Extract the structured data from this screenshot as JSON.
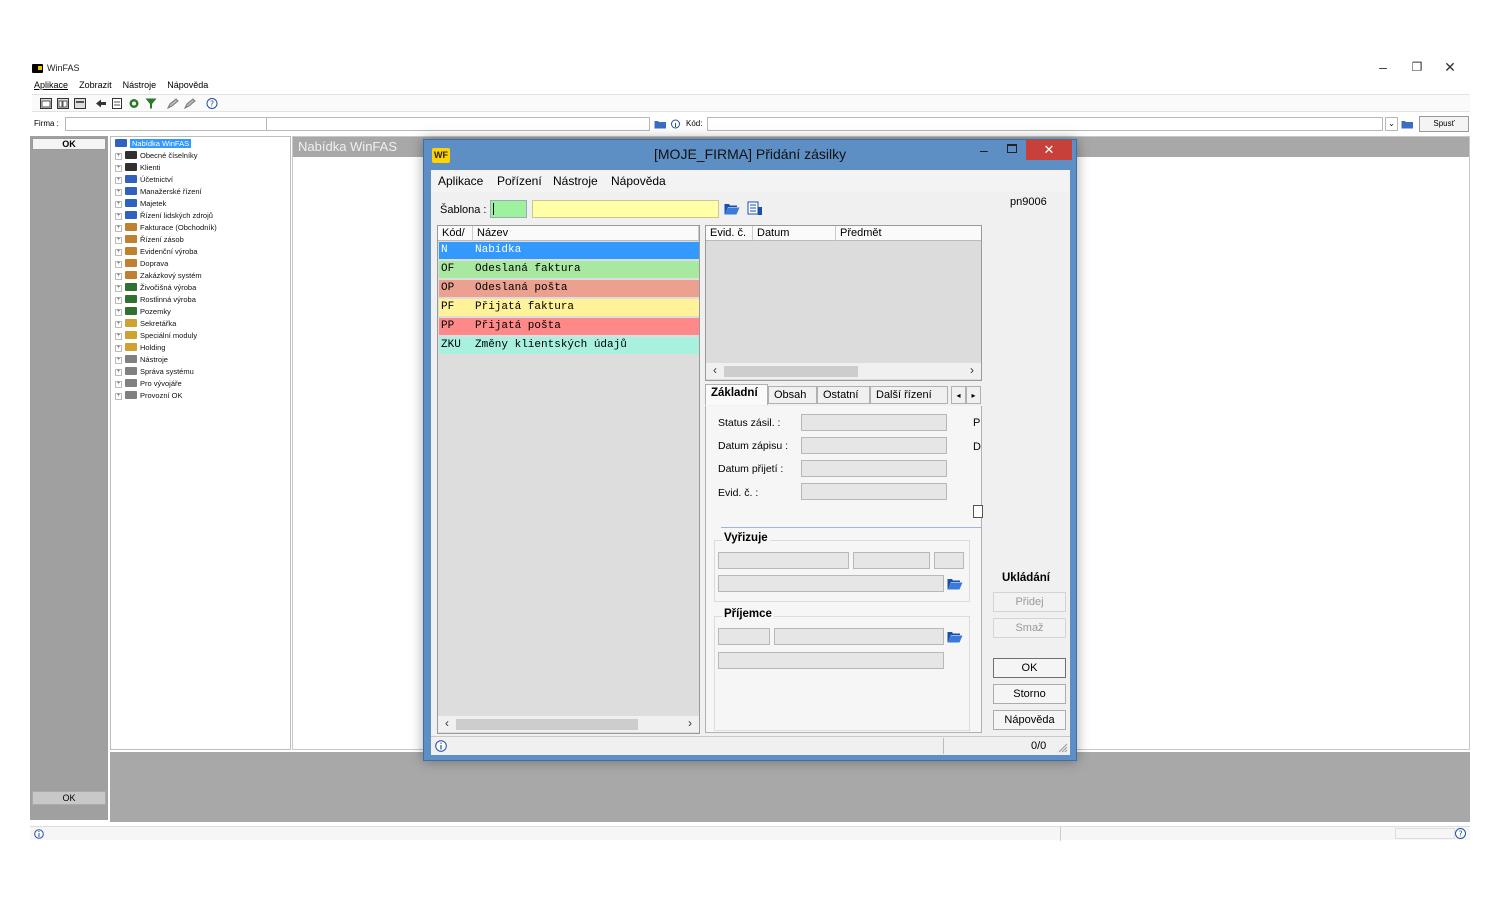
{
  "main": {
    "title": "WinFAS",
    "menus": [
      "Aplikace",
      "Zobrazit",
      "Nástroje",
      "Nápověda"
    ],
    "filter": {
      "firma_label": "Firma :",
      "kod_label": "Kód:",
      "spust_label": "Spusť"
    },
    "left_ok_top": "OK",
    "left_ok_bottom": "OK",
    "panel_title": "Nabídka WinFAS",
    "tree": [
      {
        "label": "Nabídka WinFAS",
        "color": "#3060c0",
        "selected": true
      },
      {
        "label": "Obecné číselníky",
        "color": "#303030"
      },
      {
        "label": "Klienti",
        "color": "#303030"
      },
      {
        "label": "Účetnictví",
        "color": "#3060c0"
      },
      {
        "label": "Manažerské řízení",
        "color": "#3060c0"
      },
      {
        "label": "Majetek",
        "color": "#3060c0"
      },
      {
        "label": "Řízení lidských zdrojů",
        "color": "#3060c0"
      },
      {
        "label": "Fakturace (Obchodník)",
        "color": "#c08030"
      },
      {
        "label": "Řízení zásob",
        "color": "#c08030"
      },
      {
        "label": "Evidenční výroba",
        "color": "#c08030"
      },
      {
        "label": "Doprava",
        "color": "#c08030"
      },
      {
        "label": "Zakázkový systém",
        "color": "#c08030"
      },
      {
        "label": "Živočišná výroba",
        "color": "#307030"
      },
      {
        "label": "Rostlinná výroba",
        "color": "#307030"
      },
      {
        "label": "Pozemky",
        "color": "#307030"
      },
      {
        "label": "Sekretářka",
        "color": "#d0a030"
      },
      {
        "label": "Speciální moduly",
        "color": "#d0a030"
      },
      {
        "label": "Holding",
        "color": "#d0a030"
      },
      {
        "label": "Nástroje",
        "color": "#808080"
      },
      {
        "label": "Správa systému",
        "color": "#808080"
      },
      {
        "label": "Pro vývojáře",
        "color": "#808080"
      },
      {
        "label": "Provozní OK",
        "color": "#808080"
      }
    ]
  },
  "dialog": {
    "title": "[MOJE_FIRMA] Přidání zásilky",
    "logo": "WF",
    "menus": [
      "Aplikace",
      "Pořízení",
      "Nástroje",
      "Nápověda"
    ],
    "sablona_label": "Šablona :",
    "list_headers": [
      "Kód/",
      "Název"
    ],
    "rows": [
      {
        "code": "N",
        "name": "Nabídka",
        "bg": "#3399ff",
        "fg": "#ffffff"
      },
      {
        "code": "OF",
        "name": "Odeslaná faktura",
        "bg": "#a8e8a0",
        "fg": "#000000"
      },
      {
        "code": "OP",
        "name": "Odeslaná pošta",
        "bg": "#eba090",
        "fg": "#000000"
      },
      {
        "code": "PF",
        "name": "Přijatá faktura",
        "bg": "#fff298",
        "fg": "#000000"
      },
      {
        "code": "PP",
        "name": "Přijatá pošta",
        "bg": "#ff8888",
        "fg": "#000000"
      },
      {
        "code": "ZKU",
        "name": "Změny klientských údajů",
        "bg": "#a8f0e0",
        "fg": "#000000"
      }
    ],
    "grid_headers": [
      "Evid. č.",
      "Datum",
      "Předmět"
    ],
    "tabs": [
      "Základní",
      "Obsah",
      "Ostatní",
      "Další řízení"
    ],
    "fields": [
      "Status zásil. :",
      "Datum zápisu :",
      "Datum přijetí :",
      "Evid. č. :"
    ],
    "field_side_letters": [
      "P",
      "D"
    ],
    "group_vyrizuje": "Vyřizuje",
    "group_prijemce": "Příjemce",
    "user_code": "pn9006",
    "ukladani_label": "Ukládání",
    "buttons": {
      "pridej": "Přidej",
      "smaz": "Smaž",
      "ok": "OK",
      "storno": "Storno",
      "napoveda": "Nápověda"
    },
    "status_counter": "0/0"
  }
}
